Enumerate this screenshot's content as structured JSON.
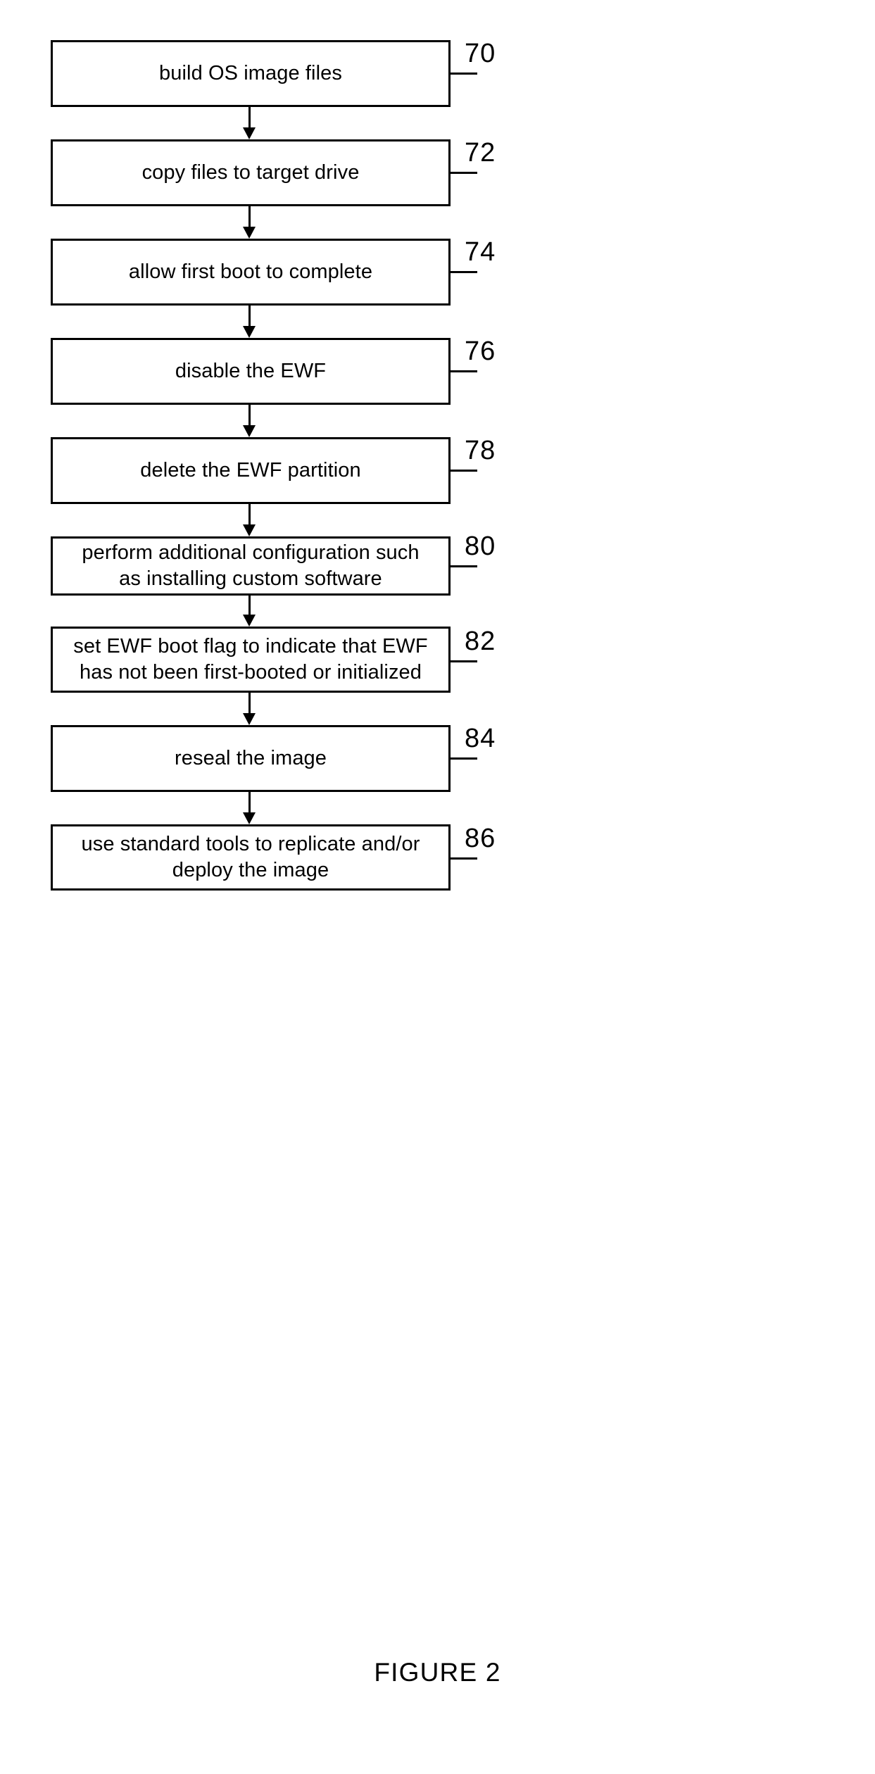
{
  "figure": {
    "caption": "FIGURE 2",
    "type": "process-flowchart"
  },
  "chart_data": {
    "type": "flowchart",
    "title": "FIGURE 2",
    "orientation": "vertical-top-to-bottom",
    "node_count": 9,
    "connector_count": 8,
    "nodes": [
      {
        "ref": "70",
        "text": "build OS image files"
      },
      {
        "ref": "72",
        "text": "copy files to target drive"
      },
      {
        "ref": "74",
        "text": "allow first boot to complete"
      },
      {
        "ref": "76",
        "text": "disable the EWF"
      },
      {
        "ref": "78",
        "text": "delete the EWF partition"
      },
      {
        "ref": "80",
        "text": "perform additional configuration such\nas installing custom software"
      },
      {
        "ref": "82",
        "text": "set EWF boot flag to indicate that EWF\nhas not been first-booted or initialized"
      },
      {
        "ref": "84",
        "text": "reseal the image"
      },
      {
        "ref": "86",
        "text": "use standard tools to replicate and/or\ndeploy the image"
      }
    ],
    "edges": [
      {
        "from": "70",
        "to": "72"
      },
      {
        "from": "72",
        "to": "74"
      },
      {
        "from": "74",
        "to": "76"
      },
      {
        "from": "76",
        "to": "78"
      },
      {
        "from": "78",
        "to": "80"
      },
      {
        "from": "80",
        "to": "82"
      },
      {
        "from": "82",
        "to": "84"
      },
      {
        "from": "84",
        "to": "86"
      }
    ],
    "colors": {
      "stroke": "#000000",
      "fill": "#ffffff",
      "text": "#000000"
    }
  }
}
